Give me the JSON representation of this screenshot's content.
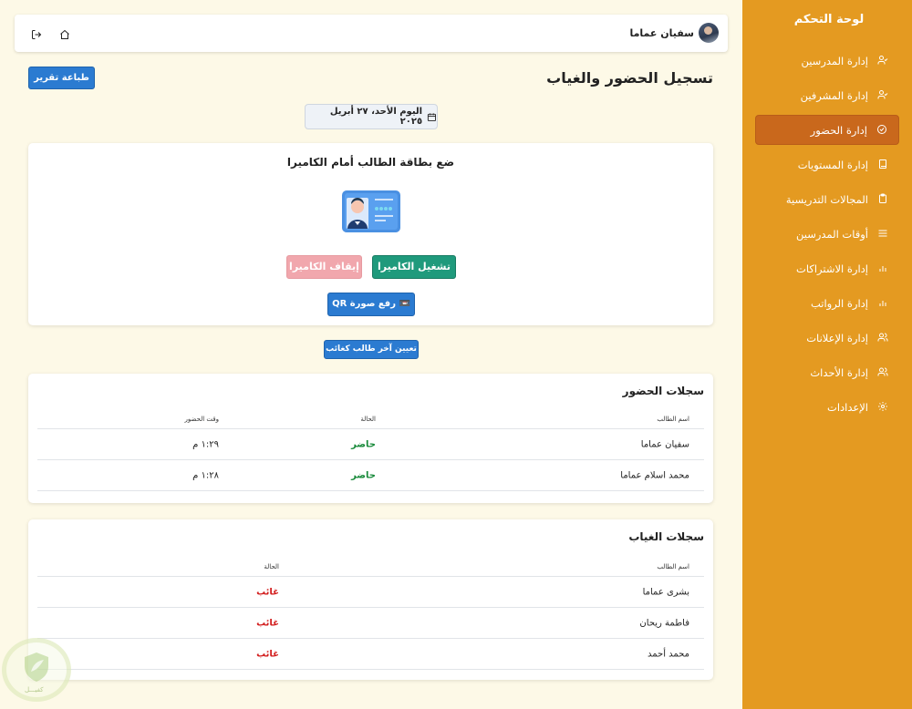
{
  "sidebar": {
    "title": "لوحة التحكم",
    "items": [
      {
        "label": "إدارة المدرسين",
        "icon": "user-check-icon"
      },
      {
        "label": "إدارة المشرفين",
        "icon": "user-check-icon"
      },
      {
        "label": "إدارة الحضور",
        "icon": "check-circle-icon",
        "active": true
      },
      {
        "label": "إدارة المستويات",
        "icon": "book-icon"
      },
      {
        "label": "المجالات التدريسية",
        "icon": "clipboard-icon"
      },
      {
        "label": "أوقات المدرسين",
        "icon": "menu-icon"
      },
      {
        "label": "إدارة الاشتراكات",
        "icon": "bar-chart-icon"
      },
      {
        "label": "إدارة الرواتب",
        "icon": "bar-chart-icon"
      },
      {
        "label": "إدارة الإعلانات",
        "icon": "users-icon"
      },
      {
        "label": "إدارة الأحداث",
        "icon": "users-icon"
      },
      {
        "label": "الإعدادات",
        "icon": "gear-icon"
      }
    ]
  },
  "topbar": {
    "user_name": "سفيان عماما"
  },
  "header": {
    "title": "تسجيل الحضور والغياب",
    "print_label": "طباعة تقرير",
    "date": "اليوم الأحد، ٢٧ أبريل ٢٠٢٥"
  },
  "scan": {
    "title": "ضع بطاقة الطالب أمام الكاميرا",
    "start_label": "تشغيل الكاميرا",
    "stop_label": "إيقاف الكاميرا",
    "qr_label": "📼 رفع صورة QR",
    "assign_label": "تعيين آخر طالب كغائب"
  },
  "attendance": {
    "title": "سجلات الحضور",
    "headers": {
      "name": "اسم الطالب",
      "status": "الحالة",
      "time": "وقت الحضور"
    },
    "rows": [
      {
        "name": "سفيان عماما",
        "status": "حاضر",
        "time": "١:٢٩ م"
      },
      {
        "name": "محمد اسلام عماما",
        "status": "حاضر",
        "time": "١:٢٨ م"
      }
    ]
  },
  "absence": {
    "title": "سجلات الغياب",
    "headers": {
      "name": "اسم الطالب",
      "status": "الحالة"
    },
    "rows": [
      {
        "name": "بشرى عماما",
        "status": "غائب"
      },
      {
        "name": "فاطمة ريحان",
        "status": "غائب"
      },
      {
        "name": "محمد أحمد",
        "status": "غائب"
      }
    ]
  },
  "watermark": {
    "text": "كفيـــل"
  },
  "colors": {
    "sidebar": "#e49a21",
    "sidebar_active": "#c9681c",
    "primary": "#2b7bd1",
    "success": "#1f9a7c",
    "present": "#188a3a",
    "absent": "#d21d1d",
    "background": "#fdf9e7"
  }
}
